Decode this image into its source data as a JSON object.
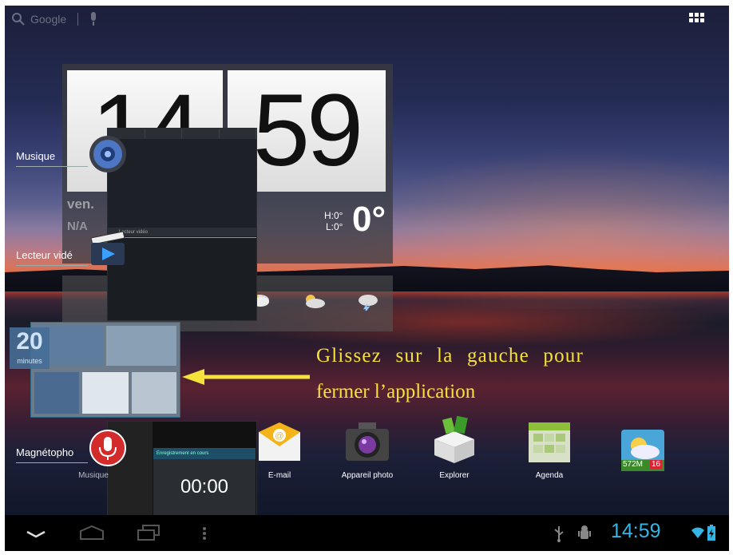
{
  "search": {
    "label": "Google"
  },
  "clock": {
    "hours": "14",
    "minutes": "59",
    "date": "ven.",
    "location": "N/A",
    "high": "H:0°",
    "low": "L:0°",
    "temp": "0°"
  },
  "recents": [
    {
      "label": "Musique",
      "icon": "speaker-icon"
    },
    {
      "label": "Lecteur vidé",
      "icon": "clapperboard-icon"
    },
    {
      "label": "Magnétopho",
      "icon": "microphone-icon"
    }
  ],
  "news": {
    "logo": "20",
    "logo_sub": "minutes"
  },
  "recorder": {
    "banner": "Enregistrement en cours",
    "timer": "00:00"
  },
  "video": {
    "header": "Lecteur vidéo"
  },
  "dock": [
    {
      "label": "Musique",
      "icon": "music-icon"
    },
    {
      "label": "E-mail",
      "icon": "email-icon"
    },
    {
      "label": "Appareil photo",
      "icon": "camera-icon"
    },
    {
      "label": "Explorer",
      "icon": "explorer-box-icon"
    },
    {
      "label": "Agenda",
      "icon": "calendar-icon"
    },
    {
      "label": "572M",
      "sub": "16",
      "icon": "weather-widget-icon"
    }
  ],
  "annotation": {
    "line1": "Glissez sur la gauche pour",
    "line2": "fermer l’application"
  },
  "statusbar": {
    "time": "14:59"
  },
  "colors": {
    "accent": "#33b5e5",
    "annotation": "#f5e23a"
  }
}
